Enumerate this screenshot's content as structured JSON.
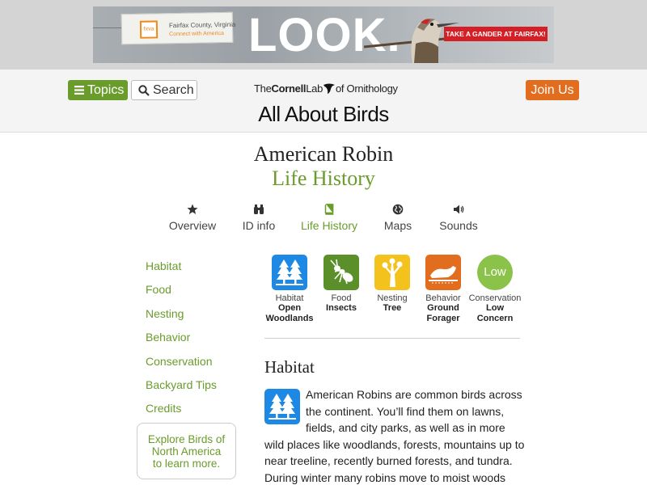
{
  "ad": {
    "tag_logo": "fxva",
    "tag_line1": "Fairfax County, Virginia",
    "tag_line2": "Connect with America",
    "headline": "LOOK.",
    "cta": "TAKE A GANDER AT FAIRFAX!"
  },
  "header": {
    "topics_label": "Topics",
    "search_label": "Search",
    "join_label": "Join Us",
    "logo_the": "The",
    "logo_cornell": "Cornell",
    "logo_lab": "Lab",
    "logo_ornith": "of Ornithology",
    "site_title": "All About Birds"
  },
  "page": {
    "species": "American Robin",
    "section": "Life History"
  },
  "tabs": [
    {
      "label": "Overview",
      "icon": "star-icon"
    },
    {
      "label": "ID info",
      "icon": "binoculars-icon"
    },
    {
      "label": "Life History",
      "icon": "book-icon",
      "active": true
    },
    {
      "label": "Maps",
      "icon": "globe-icon"
    },
    {
      "label": "Sounds",
      "icon": "speaker-icon"
    }
  ],
  "sidebar": {
    "items": [
      "Habitat",
      "Food",
      "Nesting",
      "Behavior",
      "Conservation",
      "Backyard Tips",
      "Credits"
    ],
    "explore_line1": "Explore Birds of",
    "explore_line2": "North America",
    "explore_line3": "to learn more."
  },
  "tiles": [
    {
      "caption": "Habitat",
      "value_line1": "Open",
      "value_line2": "Woodlands",
      "color": "#1e88e5",
      "icon": "forest-icon"
    },
    {
      "caption": "Food",
      "value_line1": "Insects",
      "value_line2": "",
      "color": "#5a8f29",
      "icon": "insect-icon"
    },
    {
      "caption": "Nesting",
      "value_line1": "Tree",
      "value_line2": "",
      "color": "#f4c21d",
      "icon": "tree-icon"
    },
    {
      "caption": "Behavior",
      "value_line1": "Ground",
      "value_line2": "Forager",
      "color": "#e36d1e",
      "icon": "bird-on-ground-icon"
    },
    {
      "caption": "Conservation",
      "value_line1": "Low",
      "value_line2": "Concern",
      "color": "#8bc34a",
      "badge": "Low"
    }
  ],
  "article": {
    "heading": "Habitat",
    "text": "American Robins are common birds across the continent. You’ll find them on lawns, fields, and city parks, as well as in more wild places like woodlands, forests, mountains up to near treeline, recently burned forests, and tundra. During winter many robins move to moist woods where berry-"
  }
}
